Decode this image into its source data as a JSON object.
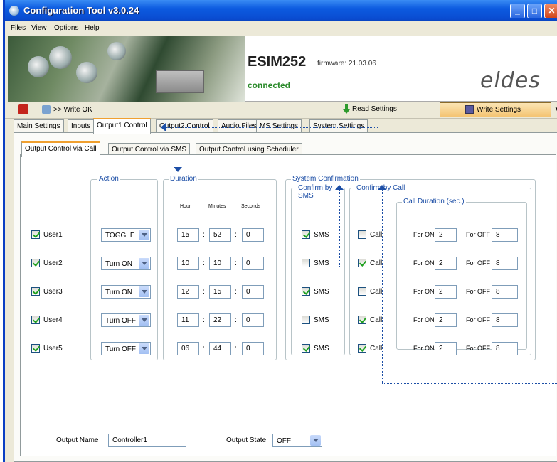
{
  "window": {
    "title": "Configuration Tool v3.0.24"
  },
  "menu": [
    "Files",
    "View",
    "Options",
    "Help"
  ],
  "banner": {
    "product": "ESIM252",
    "firmware": "firmware: 21.03.06",
    "status": "connected",
    "logo": "eldes"
  },
  "toolbar": {
    "status": ">> Write OK",
    "read_label": "Read Settings",
    "write_label": "Write Settings"
  },
  "tabs": [
    "Main Settings",
    "Inputs",
    "Output1 Control",
    "Output2 Control",
    "Audio Files",
    "MS Settings",
    "System Settings"
  ],
  "subtabs": [
    "Output Control via Call",
    "Output Control via SMS",
    "Output Control using Scheduler"
  ],
  "groups": {
    "action": "Action",
    "duration": "Duration",
    "system_confirmation": "System Confirmation",
    "confirm_sms": "Confirm by SMS",
    "confirm_call": "Confirm by Call",
    "call_duration": "Call Duration (sec.)"
  },
  "duration_headers": {
    "hour": "Hour",
    "minutes": "Minutes",
    "seconds": "Seconds"
  },
  "labels": {
    "sms": "SMS",
    "call": "Call",
    "for_on": "For ON",
    "for_off": "For OFF",
    "colon": ":"
  },
  "users": [
    {
      "name": "User1",
      "checked": true,
      "action": "TOGGLE",
      "hour": "15",
      "minutes": "52",
      "seconds": "0",
      "sms": true,
      "call": false,
      "on": "2",
      "off": "8"
    },
    {
      "name": "User2",
      "checked": true,
      "action": "Turn ON",
      "hour": "10",
      "minutes": "10",
      "seconds": "0",
      "sms": false,
      "call": true,
      "on": "2",
      "off": "8"
    },
    {
      "name": "User3",
      "checked": true,
      "action": "Turn ON",
      "hour": "12",
      "minutes": "15",
      "seconds": "0",
      "sms": true,
      "call": false,
      "on": "2",
      "off": "8"
    },
    {
      "name": "User4",
      "checked": true,
      "action": "Turn OFF",
      "hour": "11",
      "minutes": "22",
      "seconds": "0",
      "sms": false,
      "call": true,
      "on": "2",
      "off": "8"
    },
    {
      "name": "User5",
      "checked": true,
      "action": "Turn OFF",
      "hour": "06",
      "minutes": "44",
      "seconds": "0",
      "sms": true,
      "call": true,
      "on": "2",
      "off": "8"
    }
  ],
  "footer": {
    "output_name_label": "Output Name",
    "output_name_value": "Controller1",
    "output_state_label": "Output State:",
    "output_state_value": "OFF"
  },
  "colors": {
    "title_blue": "#0a4bd0",
    "group_label": "#1c4ea6",
    "connected": "#2a8a2a",
    "active_tab_accent": "#f0a030"
  }
}
